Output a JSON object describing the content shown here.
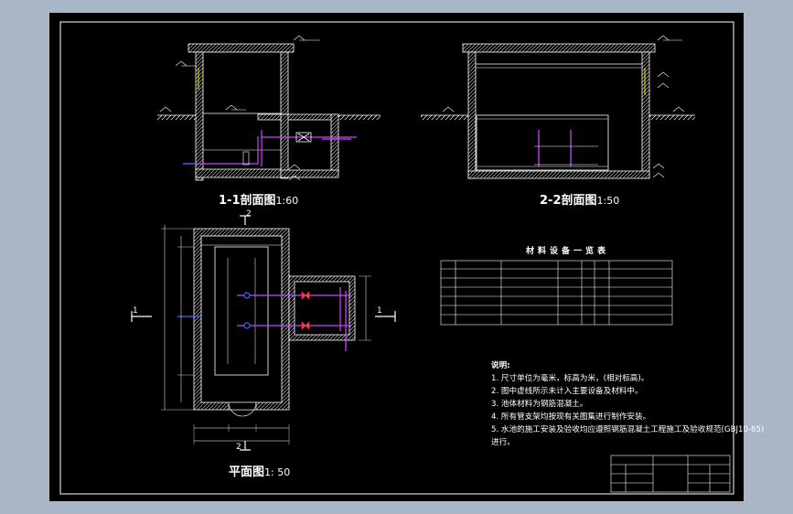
{
  "drawing": {
    "titles": {
      "section_1": "1-1剖面图",
      "section_1_scale": "1:60",
      "section_2": "2-2剖面图",
      "section_2_scale": "1:50",
      "plan": "平面图",
      "plan_scale": "1: 50"
    },
    "section_markers": [
      "1",
      "1",
      "2",
      "2"
    ],
    "materials_table": {
      "title": "材料设备一览表"
    },
    "notes": {
      "heading": "说明:",
      "items": [
        "1. 尺寸单位为毫米，标高为米，(相对标高)。",
        "2. 图中虚线所示未计入主要设备及材料中。",
        "3. 池体材料为钢筋混凝土。",
        "4. 所有管支架均按现有关图集进行制作安装。",
        "5. 水池的施工安装及验收均应遵照钢筋混凝土工程施工及验收规范(GBJ10-65)进行。"
      ]
    },
    "colors": {
      "background": "#a9b6c6",
      "sheet": "#000000",
      "lines": "#ffffff",
      "pipes": "#cc44ff",
      "valves": "#ff3355",
      "blue": "#4466ff",
      "yellow": "#ffee00"
    }
  }
}
